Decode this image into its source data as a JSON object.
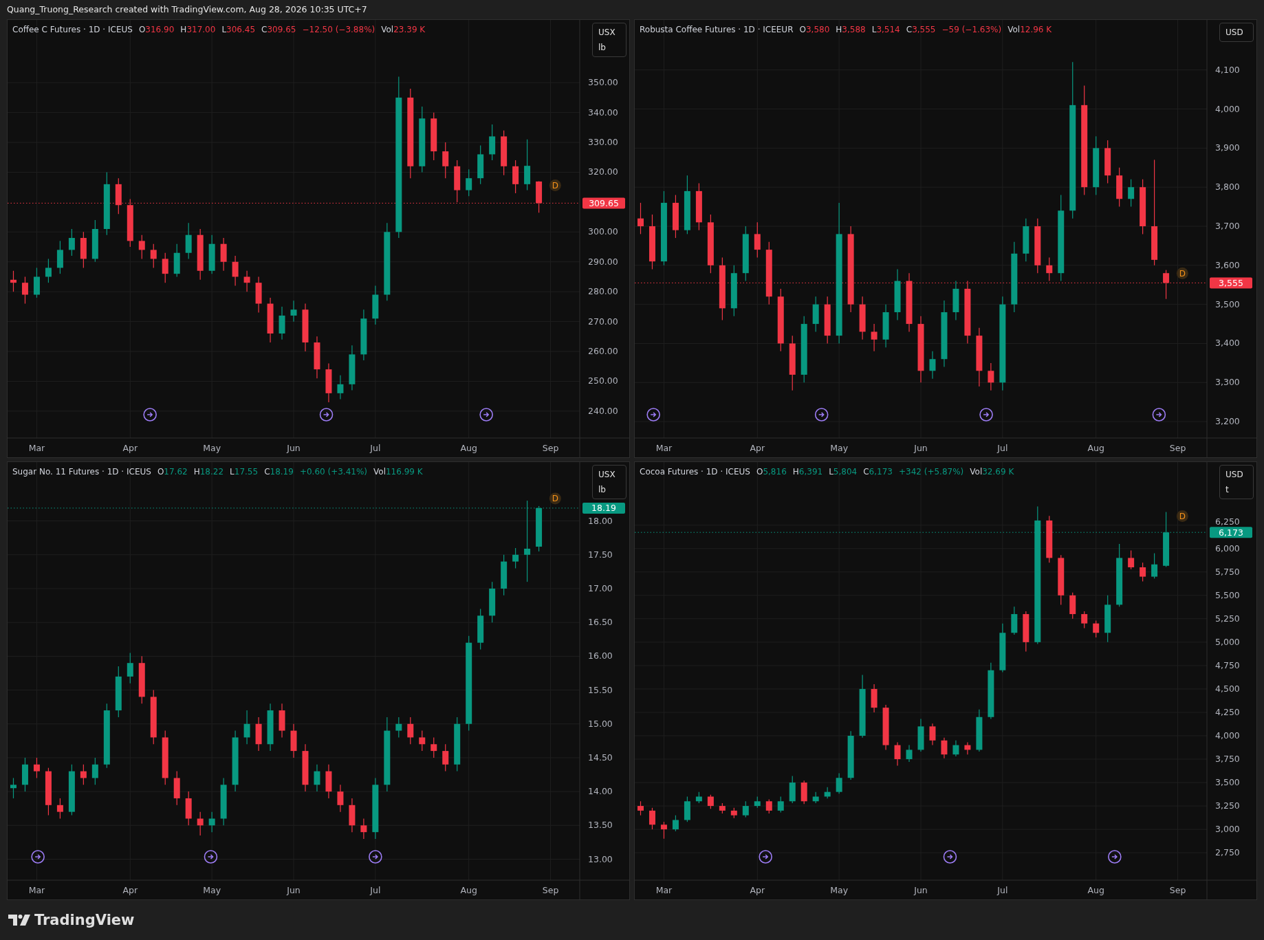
{
  "header": {
    "text": "Quang_Truong_Research created with TradingView.com, Aug 28, 2026 10:35 UTC+7"
  },
  "panes": [
    {
      "legend": {
        "symbol": "Coffee C Futures · 1D · ICEUS",
        "ohlc": [
          {
            "label": "O",
            "value": "316.90"
          },
          {
            "label": "H",
            "value": "317.00"
          },
          {
            "label": "L",
            "value": "306.45"
          },
          {
            "label": "C",
            "value": "309.65"
          }
        ],
        "change": "−12.50 (−3.88%)",
        "volume_label": "Vol",
        "volume": "23.39 K"
      },
      "units": [
        "USX",
        "lb"
      ],
      "chart_data": {
        "type": "candlestick",
        "categories": [
          null,
          null,
          "Mar",
          null,
          null,
          null,
          null,
          null,
          null,
          null,
          "Apr",
          null,
          null,
          null,
          null,
          null,
          null,
          "May",
          null,
          null,
          null,
          null,
          null,
          null,
          "Jun",
          null,
          null,
          null,
          null,
          null,
          null,
          "Jul",
          null,
          null,
          null,
          null,
          null,
          null,
          null,
          "Aug",
          null,
          null,
          null,
          null,
          null,
          null,
          "Sep"
        ],
        "ohlc": [
          [
            284,
            287,
            280,
            283
          ],
          [
            283,
            285,
            276,
            279
          ],
          [
            279,
            288,
            278,
            285
          ],
          [
            285,
            291,
            283,
            288
          ],
          [
            288,
            297,
            286,
            294
          ],
          [
            294,
            301,
            292,
            298
          ],
          [
            298,
            300,
            288,
            291
          ],
          [
            291,
            304,
            290,
            301
          ],
          [
            301,
            320,
            299,
            316
          ],
          [
            316,
            318,
            306,
            309
          ],
          [
            309,
            311,
            295,
            297
          ],
          [
            297,
            299,
            291,
            294
          ],
          [
            294,
            296,
            288,
            291
          ],
          [
            291,
            293,
            283,
            286
          ],
          [
            286,
            296,
            285,
            293
          ],
          [
            293,
            303,
            291,
            299
          ],
          [
            299,
            301,
            284,
            287
          ],
          [
            287,
            299,
            286,
            296
          ],
          [
            296,
            298,
            287,
            290
          ],
          [
            290,
            292,
            282,
            285
          ],
          [
            285,
            287,
            280,
            283
          ],
          [
            283,
            285,
            273,
            276
          ],
          [
            276,
            278,
            263,
            266
          ],
          [
            266,
            275,
            264,
            272
          ],
          [
            272,
            277,
            270,
            274
          ],
          [
            274,
            276,
            260,
            263
          ],
          [
            263,
            265,
            251,
            254
          ],
          [
            254,
            256,
            243,
            246
          ],
          [
            246,
            252,
            244,
            249
          ],
          [
            249,
            262,
            247,
            259
          ],
          [
            259,
            274,
            257,
            271
          ],
          [
            271,
            282,
            269,
            279
          ],
          [
            279,
            303,
            277,
            300
          ],
          [
            300,
            352,
            298,
            345
          ],
          [
            345,
            348,
            318,
            322
          ],
          [
            322,
            342,
            320,
            338
          ],
          [
            338,
            340,
            324,
            327
          ],
          [
            327,
            330,
            318,
            322
          ],
          [
            322,
            324,
            310,
            314
          ],
          [
            314,
            321,
            312,
            318
          ],
          [
            318,
            329,
            316,
            326
          ],
          [
            326,
            336,
            324,
            332
          ],
          [
            332,
            334,
            319,
            322
          ],
          [
            322,
            324,
            313,
            316
          ],
          [
            316,
            331,
            314,
            322.15
          ],
          [
            316.9,
            317,
            306.45,
            309.65
          ],
          null
        ],
        "ylim": [
          231,
          371
        ],
        "yticks": [
          {
            "value": 240,
            "label": "240.00"
          },
          {
            "value": 250,
            "label": "250.00"
          },
          {
            "value": 260,
            "label": "260.00"
          },
          {
            "value": 270,
            "label": "270.00"
          },
          {
            "value": 280,
            "label": "280.00"
          },
          {
            "value": 290,
            "label": "290.00"
          },
          {
            "value": 300,
            "label": "300.00"
          },
          {
            "value": 320,
            "label": "320.00"
          },
          {
            "value": 330,
            "label": "330.00"
          },
          {
            "value": 340,
            "label": "340.00"
          },
          {
            "value": 350,
            "label": "350.00"
          }
        ],
        "grid": true,
        "ref_lines": [
          {
            "axis": "y",
            "value": 309.65,
            "label": "309.65"
          }
        ],
        "annotations": [
          {
            "text": "D"
          }
        ]
      }
    },
    {
      "legend": {
        "symbol": "Robusta Coffee Futures · 1D · ICEEUR",
        "ohlc": [
          {
            "label": "O",
            "value": "3,580"
          },
          {
            "label": "H",
            "value": "3,588"
          },
          {
            "label": "L",
            "value": "3,514"
          },
          {
            "label": "C",
            "value": "3,555"
          }
        ],
        "change": "−59 (−1.63%)",
        "volume_label": "Vol",
        "volume": "12.96 K"
      },
      "units": [
        "USD"
      ],
      "chart_data": {
        "type": "candlestick",
        "categories": [
          null,
          null,
          "Mar",
          null,
          null,
          null,
          null,
          null,
          null,
          null,
          "Apr",
          null,
          null,
          null,
          null,
          null,
          null,
          "May",
          null,
          null,
          null,
          null,
          null,
          null,
          "Jun",
          null,
          null,
          null,
          null,
          null,
          null,
          "Jul",
          null,
          null,
          null,
          null,
          null,
          null,
          null,
          "Aug",
          null,
          null,
          null,
          null,
          null,
          null,
          "Sep"
        ],
        "ohlc": [
          [
            3720,
            3760,
            3680,
            3700
          ],
          [
            3700,
            3730,
            3590,
            3610
          ],
          [
            3610,
            3790,
            3600,
            3760
          ],
          [
            3760,
            3780,
            3670,
            3690
          ],
          [
            3690,
            3830,
            3680,
            3790
          ],
          [
            3790,
            3810,
            3690,
            3710
          ],
          [
            3710,
            3730,
            3580,
            3600
          ],
          [
            3600,
            3620,
            3460,
            3490
          ],
          [
            3490,
            3600,
            3470,
            3580
          ],
          [
            3580,
            3700,
            3560,
            3680
          ],
          [
            3680,
            3710,
            3620,
            3640
          ],
          [
            3640,
            3660,
            3500,
            3520
          ],
          [
            3520,
            3540,
            3380,
            3400
          ],
          [
            3400,
            3420,
            3280,
            3320
          ],
          [
            3320,
            3470,
            3300,
            3450
          ],
          [
            3450,
            3520,
            3430,
            3500
          ],
          [
            3500,
            3520,
            3400,
            3420
          ],
          [
            3420,
            3760,
            3400,
            3680
          ],
          [
            3680,
            3700,
            3480,
            3500
          ],
          [
            3500,
            3520,
            3410,
            3430
          ],
          [
            3430,
            3450,
            3380,
            3410
          ],
          [
            3410,
            3500,
            3390,
            3480
          ],
          [
            3480,
            3590,
            3460,
            3560
          ],
          [
            3560,
            3580,
            3430,
            3450
          ],
          [
            3450,
            3470,
            3300,
            3330
          ],
          [
            3330,
            3380,
            3310,
            3360
          ],
          [
            3360,
            3510,
            3340,
            3480
          ],
          [
            3480,
            3560,
            3460,
            3540
          ],
          [
            3540,
            3560,
            3400,
            3420
          ],
          [
            3420,
            3440,
            3290,
            3330
          ],
          [
            3330,
            3350,
            3280,
            3300
          ],
          [
            3300,
            3520,
            3280,
            3500
          ],
          [
            3500,
            3660,
            3480,
            3630
          ],
          [
            3630,
            3720,
            3610,
            3700
          ],
          [
            3700,
            3720,
            3580,
            3600
          ],
          [
            3600,
            3620,
            3560,
            3580
          ],
          [
            3580,
            3780,
            3560,
            3740
          ],
          [
            3740,
            4120,
            3720,
            4010
          ],
          [
            4010,
            4060,
            3780,
            3800
          ],
          [
            3800,
            3930,
            3780,
            3900
          ],
          [
            3900,
            3920,
            3810,
            3830
          ],
          [
            3830,
            3850,
            3750,
            3770
          ],
          [
            3770,
            3820,
            3750,
            3800
          ],
          [
            3800,
            3820,
            3680,
            3700
          ],
          [
            3700,
            3870,
            3600,
            3614
          ],
          [
            3580,
            3588,
            3514,
            3555
          ],
          null
        ],
        "ylim": [
          3158,
          4228
        ],
        "yticks": [
          {
            "value": 3200,
            "label": "3,200"
          },
          {
            "value": 3300,
            "label": "3,300"
          },
          {
            "value": 3400,
            "label": "3,400"
          },
          {
            "value": 3500,
            "label": "3,500"
          },
          {
            "value": 3600,
            "label": "3,600"
          },
          {
            "value": 3700,
            "label": "3,700"
          },
          {
            "value": 3800,
            "label": "3,800"
          },
          {
            "value": 3900,
            "label": "3,900"
          },
          {
            "value": 4000,
            "label": "4,000"
          },
          {
            "value": 4100,
            "label": "4,100"
          }
        ],
        "grid": true,
        "ref_lines": [
          {
            "axis": "y",
            "value": 3555,
            "label": "3,555"
          }
        ],
        "annotations": [
          {
            "text": "D"
          }
        ]
      }
    },
    {
      "legend": {
        "symbol": "Sugar No. 11 Futures · 1D · ICEUS",
        "ohlc": [
          {
            "label": "O",
            "value": "17.62"
          },
          {
            "label": "H",
            "value": "18.22"
          },
          {
            "label": "L",
            "value": "17.55"
          },
          {
            "label": "C",
            "value": "18.19"
          }
        ],
        "change": "+0.60 (+3.41%)",
        "volume_label": "Vol",
        "volume": "116.99 K"
      },
      "units": [
        "USX",
        "lb"
      ],
      "chart_data": {
        "type": "candlestick",
        "categories": [
          null,
          null,
          "Mar",
          null,
          null,
          null,
          null,
          null,
          null,
          null,
          "Apr",
          null,
          null,
          null,
          null,
          null,
          null,
          "May",
          null,
          null,
          null,
          null,
          null,
          null,
          "Jun",
          null,
          null,
          null,
          null,
          null,
          null,
          "Jul",
          null,
          null,
          null,
          null,
          null,
          null,
          null,
          "Aug",
          null,
          null,
          null,
          null,
          null,
          null,
          "Sep"
        ],
        "ohlc": [
          [
            14.05,
            14.2,
            13.9,
            14.1
          ],
          [
            14.1,
            14.5,
            14.0,
            14.4
          ],
          [
            14.4,
            14.5,
            14.2,
            14.3
          ],
          [
            14.3,
            14.35,
            13.65,
            13.8
          ],
          [
            13.8,
            13.9,
            13.6,
            13.7
          ],
          [
            13.7,
            14.4,
            13.65,
            14.3
          ],
          [
            14.3,
            14.4,
            14.1,
            14.2
          ],
          [
            14.2,
            14.5,
            14.1,
            14.4
          ],
          [
            14.4,
            15.3,
            14.35,
            15.2
          ],
          [
            15.2,
            15.85,
            15.1,
            15.7
          ],
          [
            15.7,
            16.05,
            15.6,
            15.9
          ],
          [
            15.9,
            16.0,
            15.3,
            15.4
          ],
          [
            15.4,
            15.5,
            14.7,
            14.8
          ],
          [
            14.8,
            14.9,
            14.1,
            14.2
          ],
          [
            14.2,
            14.3,
            13.8,
            13.9
          ],
          [
            13.9,
            14.0,
            13.5,
            13.6
          ],
          [
            13.6,
            13.7,
            13.35,
            13.5
          ],
          [
            13.5,
            13.7,
            13.4,
            13.6
          ],
          [
            13.6,
            14.2,
            13.5,
            14.1
          ],
          [
            14.1,
            14.9,
            14.0,
            14.8
          ],
          [
            14.8,
            15.2,
            14.7,
            15.0
          ],
          [
            15.0,
            15.1,
            14.6,
            14.7
          ],
          [
            14.7,
            15.3,
            14.6,
            15.2
          ],
          [
            15.2,
            15.3,
            14.8,
            14.9
          ],
          [
            14.9,
            15.0,
            14.5,
            14.6
          ],
          [
            14.6,
            14.7,
            14.0,
            14.1
          ],
          [
            14.1,
            14.4,
            14.0,
            14.3
          ],
          [
            14.3,
            14.4,
            13.9,
            14.0
          ],
          [
            14.0,
            14.1,
            13.7,
            13.8
          ],
          [
            13.8,
            13.9,
            13.4,
            13.5
          ],
          [
            13.5,
            13.6,
            13.3,
            13.4
          ],
          [
            13.4,
            14.2,
            13.3,
            14.1
          ],
          [
            14.1,
            15.1,
            14.0,
            14.9
          ],
          [
            14.9,
            15.1,
            14.8,
            15.0
          ],
          [
            15.0,
            15.1,
            14.7,
            14.8
          ],
          [
            14.8,
            14.9,
            14.6,
            14.7
          ],
          [
            14.7,
            14.8,
            14.5,
            14.6
          ],
          [
            14.6,
            14.7,
            14.3,
            14.4
          ],
          [
            14.4,
            15.1,
            14.3,
            15.0
          ],
          [
            15.0,
            16.3,
            14.9,
            16.2
          ],
          [
            16.2,
            16.7,
            16.1,
            16.6
          ],
          [
            16.6,
            17.1,
            16.5,
            17.0
          ],
          [
            17.0,
            17.5,
            16.9,
            17.4
          ],
          [
            17.4,
            17.6,
            17.3,
            17.5
          ],
          [
            17.5,
            18.3,
            17.1,
            17.59
          ],
          [
            17.62,
            18.22,
            17.55,
            18.19
          ],
          null
        ],
        "ylim": [
          12.69,
          18.87
        ],
        "yticks": [
          {
            "value": 13,
            "label": "13.00"
          },
          {
            "value": 13.5,
            "label": "13.50"
          },
          {
            "value": 14,
            "label": "14.00"
          },
          {
            "value": 14.5,
            "label": "14.50"
          },
          {
            "value": 15,
            "label": "15.00"
          },
          {
            "value": 15.5,
            "label": "15.50"
          },
          {
            "value": 16,
            "label": "16.00"
          },
          {
            "value": 16.5,
            "label": "16.50"
          },
          {
            "value": 17,
            "label": "17.00"
          },
          {
            "value": 17.5,
            "label": "17.50"
          },
          {
            "value": 18,
            "label": "18.00"
          }
        ],
        "grid": true,
        "ref_lines": [
          {
            "axis": "y",
            "value": 18.19,
            "label": "18.19"
          }
        ],
        "annotations": [
          {
            "text": "D"
          }
        ]
      }
    },
    {
      "legend": {
        "symbol": "Cocoa Futures · 1D · ICEUS",
        "ohlc": [
          {
            "label": "O",
            "value": "5,816"
          },
          {
            "label": "H",
            "value": "6,391"
          },
          {
            "label": "L",
            "value": "5,804"
          },
          {
            "label": "C",
            "value": "6,173"
          }
        ],
        "change": "+342 (+5.87%)",
        "volume_label": "Vol",
        "volume": "32.69 K"
      },
      "units": [
        "USD",
        "t"
      ],
      "chart_data": {
        "type": "candlestick",
        "categories": [
          null,
          null,
          "Mar",
          null,
          null,
          null,
          null,
          null,
          null,
          null,
          "Apr",
          null,
          null,
          null,
          null,
          null,
          null,
          "May",
          null,
          null,
          null,
          null,
          null,
          null,
          "Jun",
          null,
          null,
          null,
          null,
          null,
          null,
          "Jul",
          null,
          null,
          null,
          null,
          null,
          null,
          null,
          "Aug",
          null,
          null,
          null,
          null,
          null,
          null,
          "Sep"
        ],
        "ohlc": [
          [
            3250,
            3300,
            3150,
            3200
          ],
          [
            3200,
            3230,
            3000,
            3050
          ],
          [
            3050,
            3080,
            2900,
            3000
          ],
          [
            3000,
            3150,
            2980,
            3100
          ],
          [
            3100,
            3350,
            3080,
            3300
          ],
          [
            3300,
            3400,
            3280,
            3350
          ],
          [
            3350,
            3370,
            3220,
            3250
          ],
          [
            3250,
            3280,
            3170,
            3200
          ],
          [
            3200,
            3230,
            3120,
            3150
          ],
          [
            3150,
            3300,
            3130,
            3250
          ],
          [
            3250,
            3350,
            3230,
            3300
          ],
          [
            3300,
            3320,
            3170,
            3200
          ],
          [
            3200,
            3350,
            3180,
            3300
          ],
          [
            3300,
            3570,
            3280,
            3500
          ],
          [
            3500,
            3520,
            3270,
            3300
          ],
          [
            3300,
            3400,
            3280,
            3350
          ],
          [
            3350,
            3450,
            3330,
            3400
          ],
          [
            3400,
            3600,
            3380,
            3550
          ],
          [
            3550,
            4050,
            3530,
            4000
          ],
          [
            4000,
            4650,
            3980,
            4500
          ],
          [
            4500,
            4550,
            4250,
            4300
          ],
          [
            4300,
            4330,
            3850,
            3900
          ],
          [
            3900,
            3930,
            3680,
            3750
          ],
          [
            3750,
            3900,
            3720,
            3850
          ],
          [
            3850,
            4180,
            3830,
            4100
          ],
          [
            4100,
            4130,
            3900,
            3950
          ],
          [
            3950,
            3980,
            3760,
            3800
          ],
          [
            3800,
            3950,
            3780,
            3900
          ],
          [
            3900,
            3930,
            3800,
            3850
          ],
          [
            3850,
            4280,
            3830,
            4200
          ],
          [
            4200,
            4780,
            4180,
            4700
          ],
          [
            4700,
            5200,
            4680,
            5100
          ],
          [
            5100,
            5380,
            5080,
            5300
          ],
          [
            5300,
            5330,
            4900,
            5000
          ],
          [
            5000,
            6450,
            4980,
            6300
          ],
          [
            6300,
            6350,
            5850,
            5900
          ],
          [
            5900,
            5930,
            5400,
            5500
          ],
          [
            5500,
            5530,
            5250,
            5300
          ],
          [
            5300,
            5330,
            5150,
            5200
          ],
          [
            5200,
            5230,
            5050,
            5100
          ],
          [
            5100,
            5500,
            5000,
            5400
          ],
          [
            5400,
            6050,
            5380,
            5900
          ],
          [
            5900,
            5980,
            5780,
            5800
          ],
          [
            5800,
            5850,
            5650,
            5700
          ],
          [
            5700,
            5950,
            5680,
            5831
          ],
          [
            5816,
            6391,
            5804,
            6173
          ],
          null
        ],
        "ylim": [
          2457,
          6924
        ],
        "yticks": [
          {
            "value": 2750,
            "label": "2,750"
          },
          {
            "value": 3000,
            "label": "3,000"
          },
          {
            "value": 3250,
            "label": "3,250"
          },
          {
            "value": 3500,
            "label": "3,500"
          },
          {
            "value": 3750,
            "label": "3,750"
          },
          {
            "value": 4000,
            "label": "4,000"
          },
          {
            "value": 4250,
            "label": "4,250"
          },
          {
            "value": 4500,
            "label": "4,500"
          },
          {
            "value": 4750,
            "label": "4,750"
          },
          {
            "value": 5000,
            "label": "5,000"
          },
          {
            "value": 5250,
            "label": "5,250"
          },
          {
            "value": 5500,
            "label": "5,500"
          },
          {
            "value": 5750,
            "label": "5,750"
          },
          {
            "value": 6000,
            "label": "6,000"
          },
          {
            "value": 6250,
            "label": "6,250"
          }
        ],
        "grid": true,
        "ref_lines": [
          {
            "axis": "y",
            "value": 6173,
            "label": "6,173"
          }
        ],
        "annotations": [
          {
            "text": "D"
          }
        ]
      }
    }
  ],
  "footer": {
    "brand": "TradingView"
  }
}
